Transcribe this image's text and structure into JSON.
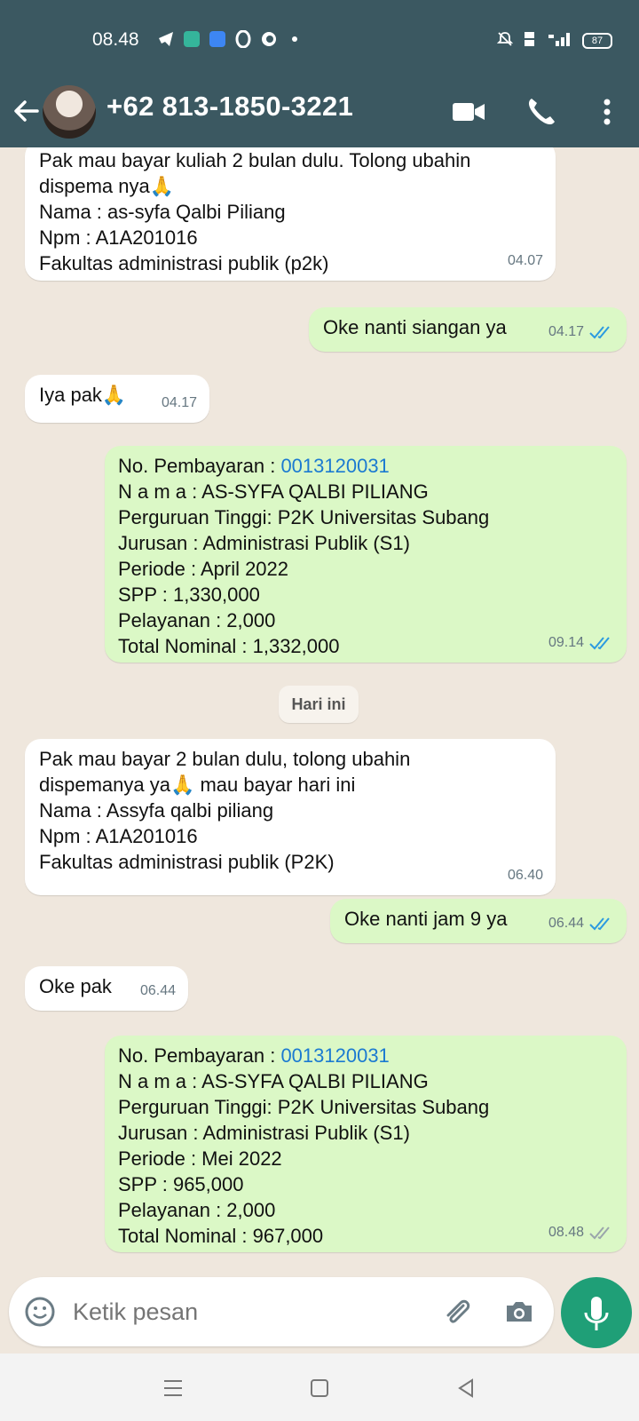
{
  "status": {
    "time": "08.48",
    "battery": "87"
  },
  "header": {
    "contact_name": "+62 813-1850-3221"
  },
  "messages": [
    {
      "type": "in",
      "text": "Pak mau bayar kuliah 2 bulan dulu. Tolong ubahin\ndispema nya🙏\nNama : as-syfa Qalbi Piliang\nNpm : A1A201016\nFakultas administrasi publik (p2k)",
      "time": "04.07"
    },
    {
      "type": "out",
      "text": "Oke nanti siangan ya",
      "time": "04.17"
    },
    {
      "type": "in",
      "text": "Iya pak🙏",
      "time": "04.17"
    },
    {
      "type": "out",
      "lines": [
        "No. Pembayaran :",
        "N a m a  :  AS-SYFA QALBI PILIANG",
        "Perguruan Tinggi:  P2K Universitas Subang",
        "Jurusan  :  Administrasi Publik (S1)",
        "Periode  :  April 2022",
        "SPP  :  1,330,000",
        "Pelayanan  :  2,000",
        "Total Nominal  :  1,332,000"
      ],
      "payment_no": "0013120031",
      "time": "09.14"
    },
    {
      "type": "in",
      "text": "Pak mau bayar 2 bulan dulu, tolong ubahin\ndispemanya ya🙏 mau bayar hari ini\nNama : Assyfa qalbi piliang\nNpm : A1A201016\nFakultas administrasi publik (P2K)",
      "time": "06.40"
    },
    {
      "type": "out",
      "text": "Oke nanti jam 9 ya",
      "time": "06.44"
    },
    {
      "type": "in",
      "text": "Oke pak",
      "time": "06.44"
    },
    {
      "type": "out",
      "lines": [
        "No. Pembayaran :",
        "N a m a  :  AS-SYFA QALBI PILIANG",
        "Perguruan Tinggi:  P2K Universitas Subang",
        "Jurusan  :  Administrasi Publik (S1)",
        "Periode  :  Mei 2022",
        "SPP  :  965,000",
        "Pelayanan  :  2,000",
        "Total Nominal  :  967,000"
      ],
      "payment_no": "0013120031",
      "time": "08.48"
    }
  ],
  "date_chip": "Hari ini",
  "composer": {
    "placeholder": "Ketik pesan"
  },
  "colors": {
    "header": "#3b5861",
    "outgoing_bubble": "#dbf8c6",
    "incoming_bubble": "#ffffff",
    "accent": "#1f9f77",
    "read_tick": "#2b9ae0"
  }
}
